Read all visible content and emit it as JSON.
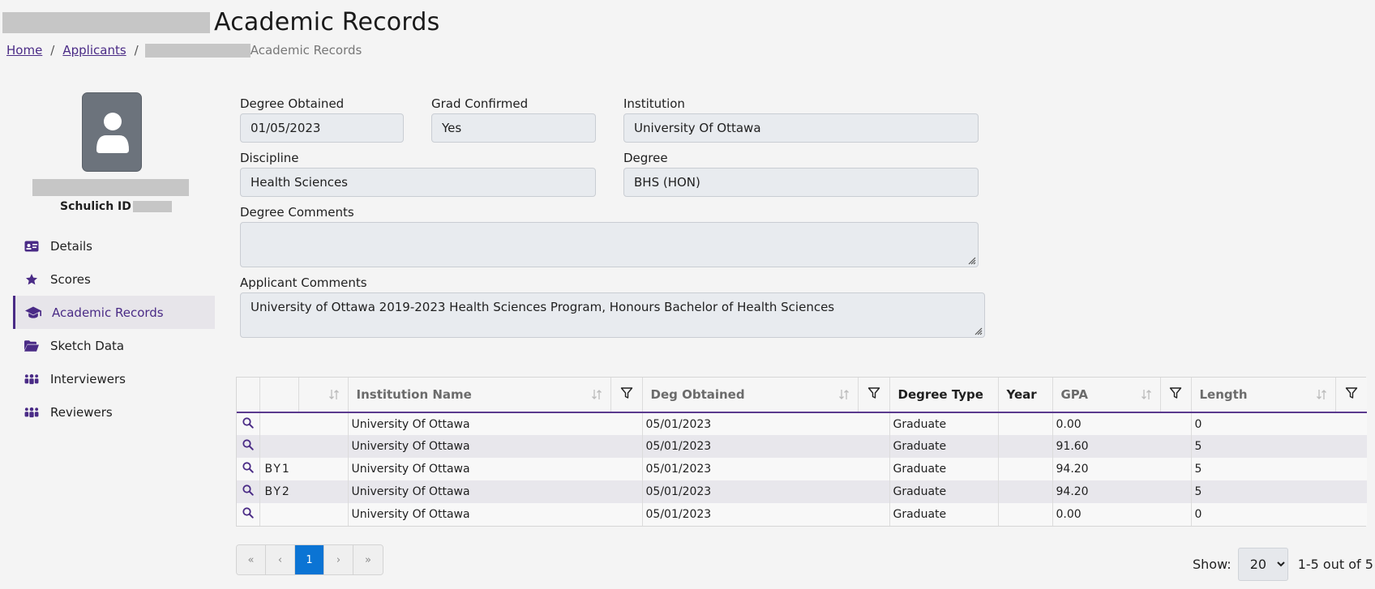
{
  "header": {
    "title": "Academic Records",
    "breadcrumb": {
      "home": "Home",
      "applicants": "Applicants",
      "current": "Academic Records"
    }
  },
  "profile": {
    "id_label": "Schulich ID"
  },
  "nav": {
    "items": [
      {
        "label": "Details",
        "icon": "id-card-icon"
      },
      {
        "label": "Scores",
        "icon": "star-icon"
      },
      {
        "label": "Academic Records",
        "icon": "graduation-cap-icon",
        "active": true
      },
      {
        "label": "Sketch Data",
        "icon": "folder-open-icon"
      },
      {
        "label": "Interviewers",
        "icon": "people-icon"
      },
      {
        "label": "Reviewers",
        "icon": "people-icon"
      }
    ]
  },
  "form": {
    "degree_obtained": {
      "label": "Degree Obtained",
      "value": "01/05/2023"
    },
    "grad_confirmed": {
      "label": "Grad Confirmed",
      "value": "Yes"
    },
    "institution": {
      "label": "Institution",
      "value": "University Of Ottawa"
    },
    "discipline": {
      "label": "Discipline",
      "value": "Health Sciences"
    },
    "degree": {
      "label": "Degree",
      "value": "BHS (HON)"
    },
    "degree_comments": {
      "label": "Degree Comments",
      "value": ""
    },
    "applicant_comments": {
      "label": "Applicant Comments",
      "value": "University of Ottawa 2019-2023 Health Sciences Program, Honours Bachelor of Health Sciences"
    }
  },
  "table": {
    "columns": {
      "institution_name": "Institution Name",
      "deg_obtained": "Deg Obtained",
      "degree_type": "Degree Type",
      "year": "Year",
      "gpa": "GPA",
      "length": "Length"
    },
    "rows": [
      {
        "code": "",
        "institution": "University Of Ottawa",
        "deg_obtained": "05/01/2023",
        "degree_type": "Graduate",
        "year": "",
        "gpa": "0.00",
        "length": "0"
      },
      {
        "code": "",
        "institution": "University Of Ottawa",
        "deg_obtained": "05/01/2023",
        "degree_type": "Graduate",
        "year": "",
        "gpa": "91.60",
        "length": "5"
      },
      {
        "code": "BY1",
        "institution": "University Of Ottawa",
        "deg_obtained": "05/01/2023",
        "degree_type": "Graduate",
        "year": "",
        "gpa": "94.20",
        "length": "5"
      },
      {
        "code": "BY2",
        "institution": "University Of Ottawa",
        "deg_obtained": "05/01/2023",
        "degree_type": "Graduate",
        "year": "",
        "gpa": "94.20",
        "length": "5"
      },
      {
        "code": "",
        "institution": "University Of Ottawa",
        "deg_obtained": "05/01/2023",
        "degree_type": "Graduate",
        "year": "",
        "gpa": "0.00",
        "length": "0"
      }
    ]
  },
  "pager": {
    "first": "«",
    "prev": "‹",
    "current": "1",
    "next": "›",
    "last": "»"
  },
  "show": {
    "label": "Show:",
    "value": "20",
    "count_text": "1-5 out of 5"
  },
  "colors": {
    "accent": "#4a2b86",
    "page_active": "#0b74d4",
    "background": "#f4f4f4"
  }
}
